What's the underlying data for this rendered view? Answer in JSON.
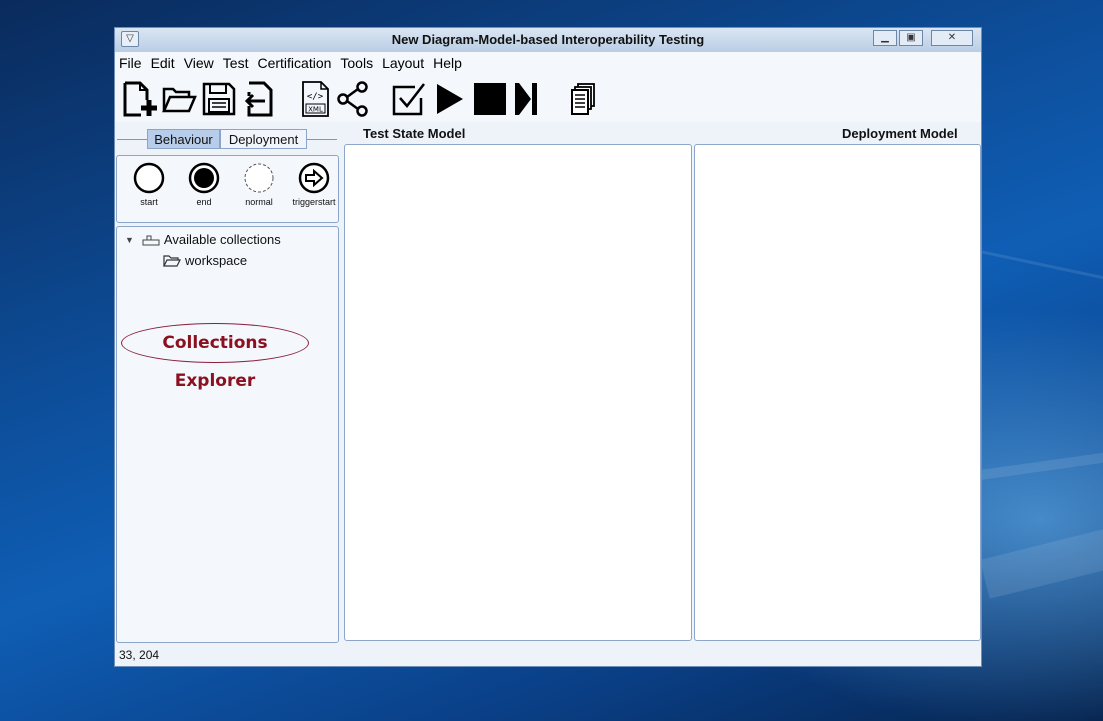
{
  "window": {
    "title": "New Diagram-Model-based Interoperability Testing"
  },
  "menu": [
    "File",
    "Edit",
    "View",
    "Test",
    "Certification",
    "Tools",
    "Layout",
    "Help"
  ],
  "toolbar": {
    "buttons": [
      {
        "name": "new-file-button",
        "icon": "file-add-icon"
      },
      {
        "name": "open-folder-button",
        "icon": "folder-open-icon"
      },
      {
        "name": "save-button",
        "icon": "floppy-icon"
      },
      {
        "name": "import-button",
        "icon": "file-import-icon"
      },
      {
        "name": "xml-export-button",
        "icon": "xml-file-icon",
        "label": "XML"
      },
      {
        "name": "share-button",
        "icon": "share-icon"
      },
      {
        "name": "validate-button",
        "icon": "checkbox-icon"
      },
      {
        "name": "play-button",
        "icon": "play-icon"
      },
      {
        "name": "stop-button",
        "icon": "stop-icon"
      },
      {
        "name": "step-button",
        "icon": "step-icon"
      },
      {
        "name": "report-button",
        "icon": "documents-icon"
      }
    ]
  },
  "left_panel": {
    "tabs": {
      "active": "Behaviour",
      "inactive": "Deployment"
    },
    "palette": [
      {
        "label": "start",
        "icon": "circle-thick-icon"
      },
      {
        "label": "end",
        "icon": "circle-filled-icon"
      },
      {
        "label": "normal",
        "icon": "circle-dashed-icon"
      },
      {
        "label": "triggerstart",
        "icon": "circle-arrow-icon"
      }
    ],
    "tree": {
      "root": "Available collections",
      "child": "workspace"
    },
    "callout": "Collections Explorer"
  },
  "headers": {
    "test_state": "Test State Model",
    "deployment": "Deployment Model"
  },
  "status": {
    "coords": "33, 204"
  },
  "colors": {
    "title_bar": "#c6d7ea",
    "tab_active": "#b7cdea",
    "callout_text": "#8b1020",
    "desktop": "#0d4c97"
  }
}
